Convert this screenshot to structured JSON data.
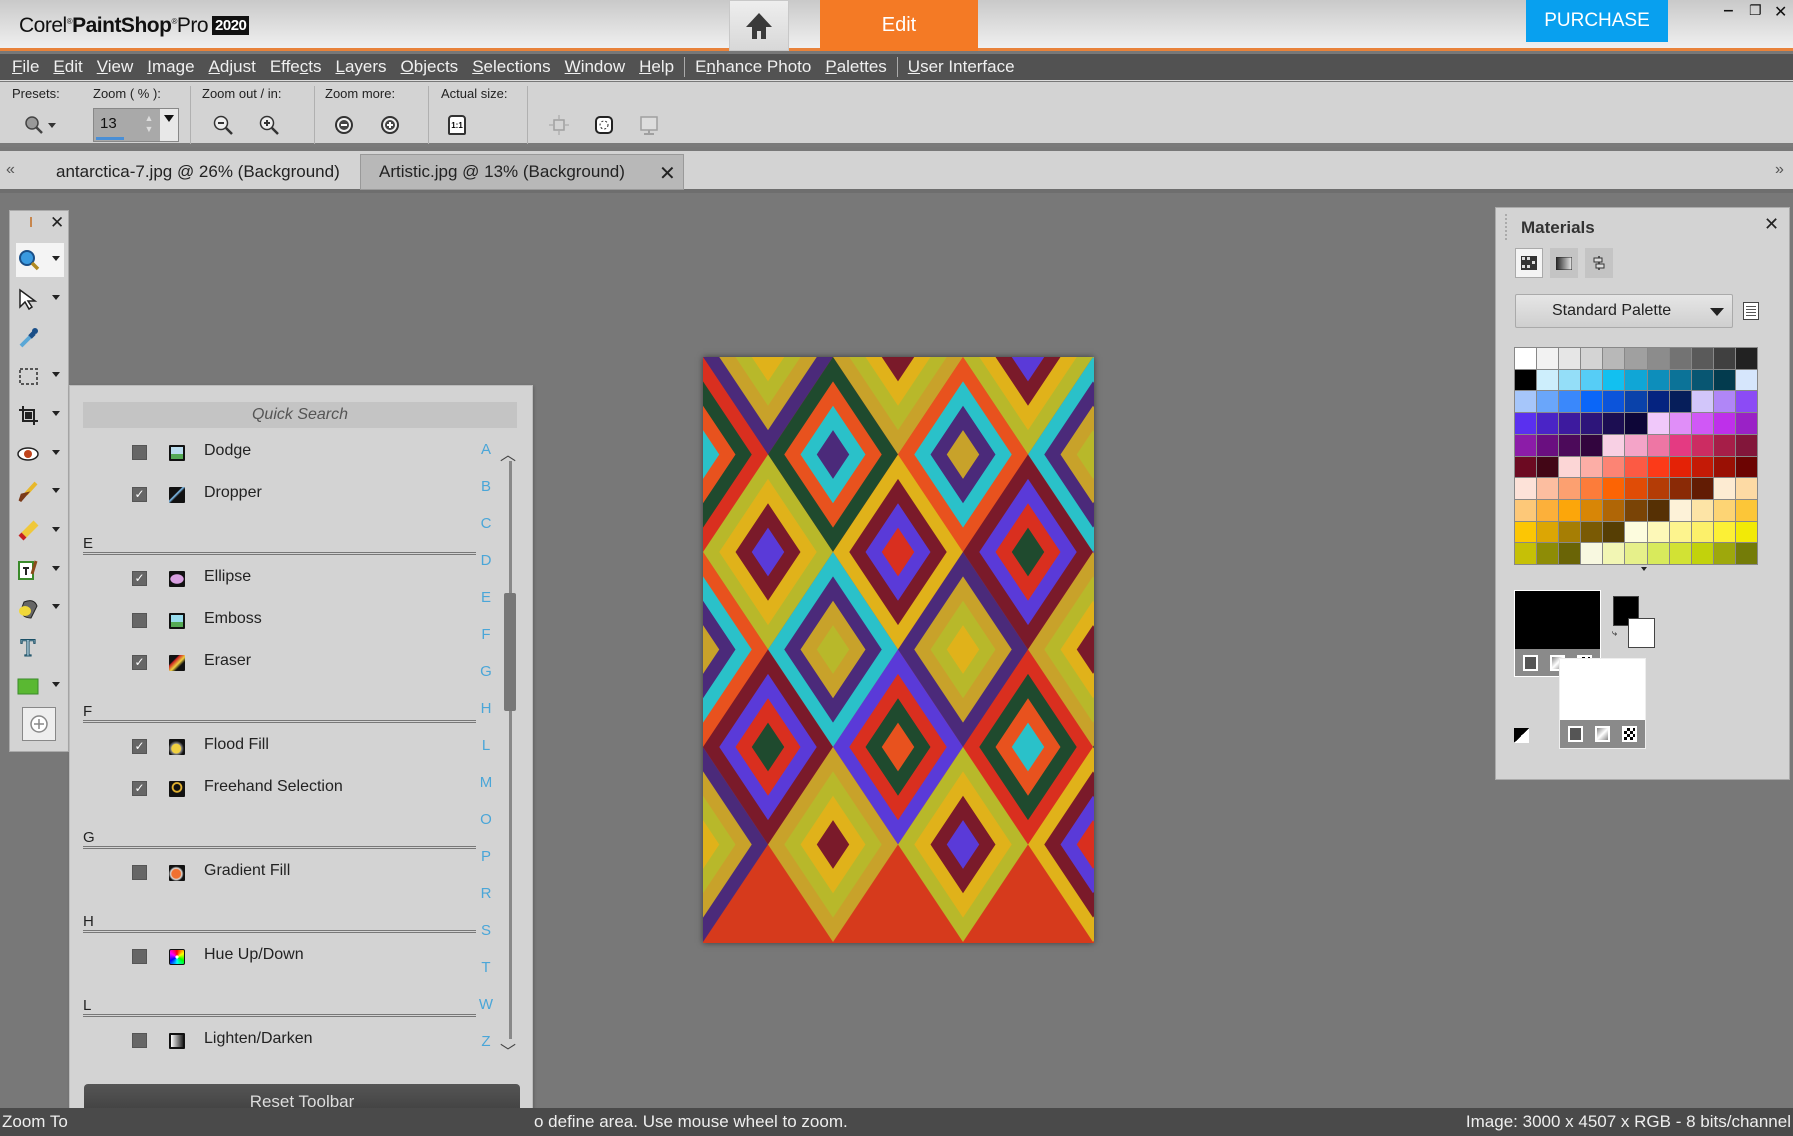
{
  "app": {
    "brand_light": "Corel",
    "brand_bold": "PaintShop",
    "brand_pro": "Pro",
    "brand_year": "2020",
    "home_icon": "home-icon",
    "mode_tab": "Edit",
    "purchase_label": "PURCHASE",
    "window_controls": [
      "minimize",
      "restore",
      "close"
    ]
  },
  "menu": [
    {
      "label": "File",
      "accel": "F"
    },
    {
      "label": "Edit",
      "accel": "E"
    },
    {
      "label": "View",
      "accel": "V"
    },
    {
      "label": "Image",
      "accel": "I"
    },
    {
      "label": "Adjust",
      "accel": "A"
    },
    {
      "label": "Effects",
      "accel": "c"
    },
    {
      "label": "Layers",
      "accel": "L"
    },
    {
      "label": "Objects",
      "accel": "O"
    },
    {
      "label": "Selections",
      "accel": "S"
    },
    {
      "label": "Window",
      "accel": "W"
    },
    {
      "label": "Help",
      "accel": "H"
    },
    {
      "label": "Enhance Photo",
      "accel": "n"
    },
    {
      "label": "Palettes",
      "accel": "P"
    },
    {
      "label": "User Interface",
      "accel": "U"
    }
  ],
  "toolbar": {
    "presets_label": "Presets:",
    "zoom_label": "Zoom ( % ):",
    "zoom_value": "13",
    "zoom_inout_label": "Zoom out / in:",
    "zoom_more_label": "Zoom more:",
    "actual_size_label": "Actual size:",
    "actual_size_icon_text": "1:1"
  },
  "tabs": [
    {
      "label": "antarctica-7.jpg @  26% (Background)",
      "active": false
    },
    {
      "label": "Artistic.jpg @  13% (Background)",
      "active": true
    }
  ],
  "tools": [
    {
      "name": "zoom-tool",
      "has_menu": true,
      "active": true
    },
    {
      "name": "pick-tool",
      "has_menu": true
    },
    {
      "name": "dropper-tool",
      "has_menu": false
    },
    {
      "name": "selection-tool",
      "has_menu": true
    },
    {
      "name": "crop-tool",
      "has_menu": true
    },
    {
      "name": "red-eye-tool",
      "has_menu": true
    },
    {
      "name": "paint-brush-tool",
      "has_menu": true
    },
    {
      "name": "eraser-tool",
      "has_menu": true
    },
    {
      "name": "clone-brush-tool",
      "has_menu": true
    },
    {
      "name": "flood-fill-tool",
      "has_menu": true
    },
    {
      "name": "text-tool",
      "has_menu": false
    },
    {
      "name": "rectangle-tool",
      "has_menu": true
    },
    {
      "name": "add-tool",
      "has_menu": false
    }
  ],
  "quick_search": {
    "placeholder": "Quick Search",
    "rows": [
      {
        "type": "item",
        "label": "Dodge",
        "checked": false,
        "icon": "dodge-icon"
      },
      {
        "type": "item",
        "label": "Dropper",
        "checked": true,
        "icon": "dropper-icon"
      },
      {
        "type": "group",
        "label": "E"
      },
      {
        "type": "item",
        "label": "Ellipse",
        "checked": true,
        "icon": "ellipse-icon"
      },
      {
        "type": "item",
        "label": "Emboss",
        "checked": false,
        "icon": "emboss-icon"
      },
      {
        "type": "item",
        "label": "Eraser",
        "checked": true,
        "icon": "eraser-icon"
      },
      {
        "type": "group",
        "label": "F"
      },
      {
        "type": "item",
        "label": "Flood Fill",
        "checked": true,
        "icon": "flood-fill-icon"
      },
      {
        "type": "item",
        "label": "Freehand Selection",
        "checked": true,
        "icon": "freehand-selection-icon"
      },
      {
        "type": "group",
        "label": "G"
      },
      {
        "type": "item",
        "label": "Gradient Fill",
        "checked": false,
        "icon": "gradient-fill-icon"
      },
      {
        "type": "group",
        "label": "H"
      },
      {
        "type": "item",
        "label": "Hue Up/Down",
        "checked": false,
        "icon": "hue-icon"
      },
      {
        "type": "group",
        "label": "L"
      },
      {
        "type": "item",
        "label": "Lighten/Darken",
        "checked": false,
        "icon": "lighten-darken-icon"
      }
    ],
    "alphabet": [
      "A",
      "B",
      "C",
      "D",
      "E",
      "F",
      "G",
      "H",
      "L",
      "M",
      "O",
      "P",
      "R",
      "S",
      "T",
      "W",
      "Z"
    ],
    "reset_label": "Reset Toolbar"
  },
  "status": {
    "left_text_start": "Zoom To",
    "left_text_end": "o define area. Use mouse wheel to zoom.",
    "image_info": "Image:  3000 x 4507 x RGB - 8 bits/channel"
  },
  "materials": {
    "title": "Materials",
    "palette_select": "Standard Palette",
    "swatches": [
      "#ffffff",
      "#f2f2f2",
      "#e6e6e6",
      "#d4d4d4",
      "#b8b8b8",
      "#a0a0a0",
      "#8c8c8c",
      "#737373",
      "#5a5a5a",
      "#404040",
      "#222222",
      "#000000",
      "#cdeefc",
      "#94def8",
      "#56cdf6",
      "#12c0f0",
      "#10a6d6",
      "#0d8ebb",
      "#0c7398",
      "#085672",
      "#033b4e",
      "#d6e6fc",
      "#a6c6fa",
      "#6aa6fa",
      "#3a88fb",
      "#0a66f8",
      "#0c54da",
      "#0a42aa",
      "#052380",
      "#061e5a",
      "#d2c6fa",
      "#b086f7",
      "#8c4bf5",
      "#5a30ef",
      "#4a24c6",
      "#3d1a9e",
      "#2d157a",
      "#1c0e52",
      "#0e0638",
      "#f0c8fa",
      "#e08ef8",
      "#d058f6",
      "#be30ea",
      "#9a22c6",
      "#8c1ca8",
      "#6a0f80",
      "#4c0a5a",
      "#32053e",
      "#f8d0e4",
      "#f4a4c8",
      "#ee76a4",
      "#e43a82",
      "#cc2c62",
      "#a61e48",
      "#82163a",
      "#6c0a22",
      "#420616",
      "#fcd6d6",
      "#fcaea6",
      "#fc8474",
      "#fc5a44",
      "#fc3a18",
      "#e42206",
      "#c41a06",
      "#9a1004",
      "#6c0402",
      "#fde2d8",
      "#fcbea0",
      "#fca070",
      "#fc7c3a",
      "#fc6404",
      "#e04c06",
      "#b43c06",
      "#8a2a06",
      "#621c04",
      "#fdebd2",
      "#fddaa4",
      "#fdc878",
      "#fcb03a",
      "#fca60a",
      "#d88606",
      "#b06606",
      "#7a4406",
      "#563004",
      "#fdf2d8",
      "#fde4a6",
      "#fdd474",
      "#fcc638",
      "#fcc604",
      "#dca604",
      "#a67e04",
      "#7a5a04",
      "#563e04",
      "#fdfcde",
      "#fdf8b8",
      "#fdf48e",
      "#fcf06a",
      "#fcf036",
      "#f2ea06",
      "#c6c006",
      "#8e8c06",
      "#6a6406",
      "#f8f8e0",
      "#f2f6b4",
      "#e6f08a",
      "#d8ea5c",
      "#d2e234",
      "#c2d20c",
      "#9ea80c",
      "#747c08"
    ],
    "foreground": "#000000",
    "background": "#ffffff"
  },
  "canvas": {
    "document": "Artistic.jpg"
  }
}
